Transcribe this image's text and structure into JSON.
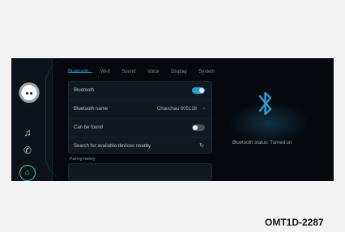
{
  "tabs": [
    "Bluetooth",
    "Wi-fi",
    "Sound",
    "Voice",
    "Display",
    "System"
  ],
  "active_tab_index": 0,
  "settings": {
    "bluetooth_label": "Bluetooth",
    "bluetooth_toggle": "on",
    "name_label": "Bluetooth name",
    "name_value": "Chauchau 005138",
    "found_label": "Can be found",
    "found_toggle": "off",
    "search_label": "Search for available devices nearby"
  },
  "pairing_label": "Pairing history",
  "status_text": "Bluetooth status: Turned on",
  "reference_code": "OMT1D-2287",
  "icons": {
    "sidebar": [
      "assistant-avatar-icon",
      "music-icon",
      "phone-icon",
      "home-icon"
    ],
    "chevron": "chevron-right-icon",
    "refresh": "refresh-icon",
    "bluetooth": "bluetooth-icon"
  },
  "colors": {
    "accent": "#2e9bd1",
    "home_ring": "#2fd69b",
    "background": "#05090d"
  }
}
